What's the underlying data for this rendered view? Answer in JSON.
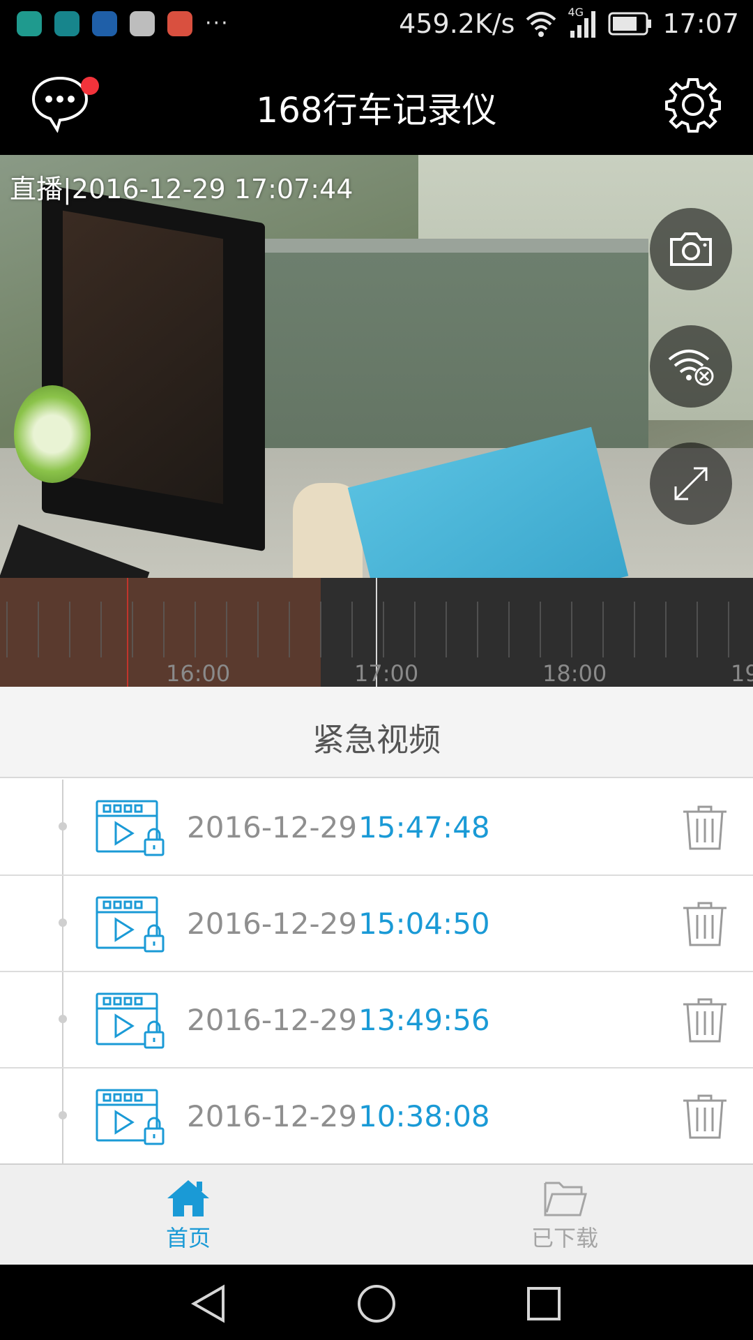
{
  "status_bar": {
    "net_speed": "459.2K/s",
    "network_type": "4G",
    "time": "17:07",
    "notification_icons": [
      "chat-app-icon",
      "huawei-app-icon",
      "sim-app-icon",
      "font-app-icon",
      "tool-app-icon"
    ],
    "more_indicator": "···"
  },
  "header": {
    "title": "168行车记录仪",
    "message_icon": "chat-bubble-icon",
    "settings_icon": "gear-icon",
    "has_unread_badge": true
  },
  "video": {
    "live_label": "直播|2016-12-29 17:07:44",
    "buttons": [
      {
        "name": "camera-snapshot-button",
        "icon": "camera-icon"
      },
      {
        "name": "wifi-disconnect-button",
        "icon": "wifi-off-icon"
      },
      {
        "name": "fullscreen-button",
        "icon": "expand-icon"
      }
    ]
  },
  "timeline": {
    "labels": [
      "16:00",
      "17:00",
      "18:00",
      "19"
    ],
    "current_time_marker": "17:00"
  },
  "section": {
    "title": "紧急视频"
  },
  "videos": [
    {
      "date": "2016-12-29",
      "time": "15:47:48"
    },
    {
      "date": "2016-12-29",
      "time": "15:04:50"
    },
    {
      "date": "2016-12-29",
      "time": "13:49:56"
    },
    {
      "date": "2016-12-29",
      "time": "10:38:08"
    }
  ],
  "bottom_nav": {
    "items": [
      {
        "label": "首页",
        "icon": "home-icon",
        "active": true
      },
      {
        "label": "已下载",
        "icon": "folder-icon",
        "active": false
      }
    ]
  },
  "colors": {
    "accent": "#1a9ad6",
    "badge": "#f2333b",
    "header_bg": "#000000",
    "timeline_recorded": "#5a3a2e"
  }
}
